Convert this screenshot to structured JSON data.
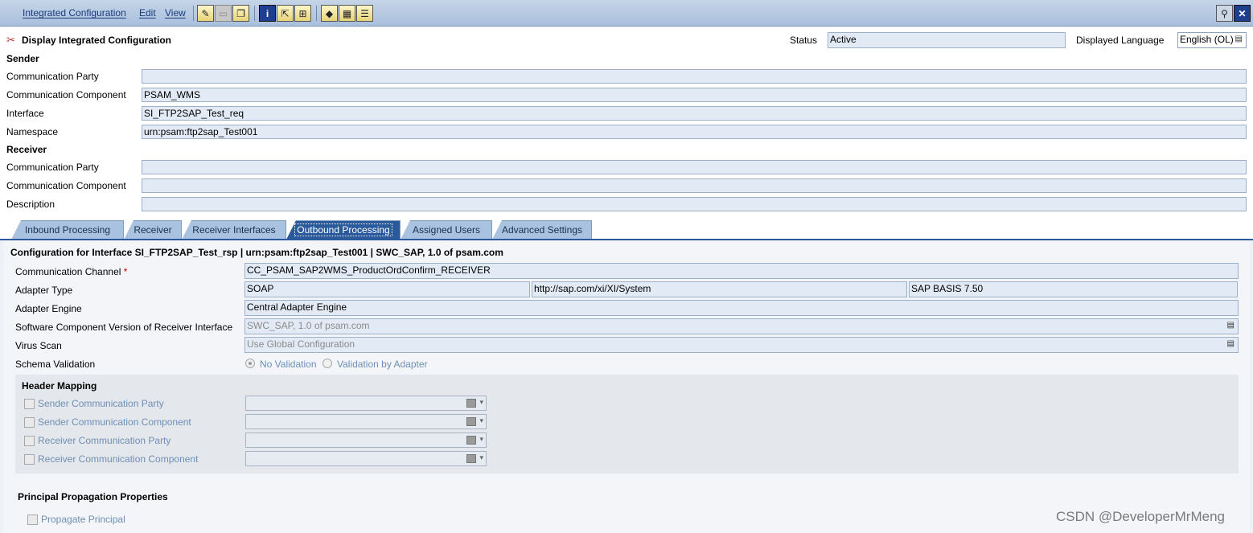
{
  "menu": {
    "integrated_config": "Integrated Configuration",
    "edit": "Edit",
    "view": "View"
  },
  "toolbar_icons": [
    "edit-pencil-icon",
    "save-icon",
    "copy-icon",
    "info-icon",
    "navigate-icon",
    "where-used-icon",
    "check-icon",
    "table-icon",
    "doc-icon",
    "pin-icon",
    "close-window-icon"
  ],
  "header": {
    "title": "Display Integrated Configuration",
    "status_label": "Status",
    "status_value": "Active",
    "language_label": "Displayed Language",
    "language_value": "English (OL)"
  },
  "sender": {
    "title": "Sender",
    "party_label": "Communication Party",
    "party_value": "",
    "component_label": "Communication Component",
    "component_value": "PSAM_WMS",
    "interface_label": "Interface",
    "interface_value": "SI_FTP2SAP_Test_req",
    "namespace_label": "Namespace",
    "namespace_value": "urn:psam:ftp2sap_Test001"
  },
  "receiver": {
    "title": "Receiver",
    "party_label": "Communication Party",
    "party_value": "",
    "component_label": "Communication Component",
    "component_value": "",
    "description_label": "Description",
    "description_value": ""
  },
  "tabs": [
    "Inbound Processing",
    "Receiver",
    "Receiver Interfaces",
    "Outbound Processing",
    "Assigned Users",
    "Advanced Settings"
  ],
  "active_tab": "Outbound Processing",
  "outbound": {
    "heading": "Configuration for Interface SI_FTP2SAP_Test_rsp | urn:psam:ftp2sap_Test001 | SWC_SAP, 1.0 of psam.com",
    "channel_label": "Communication Channel",
    "required_mark": "*",
    "channel_value": "CC_PSAM_SAP2WMS_ProductOrdConfirm_RECEIVER",
    "adapter_type_label": "Adapter Type",
    "adapter_type": "SOAP",
    "adapter_ns": "http://sap.com/xi/XI/System",
    "adapter_version": "SAP BASIS 7.50",
    "engine_label": "Adapter Engine",
    "engine_value": "Central Adapter Engine",
    "swcv_label": "Software Component Version of Receiver Interface",
    "swcv_value": "SWC_SAP, 1.0 of psam.com",
    "virus_label": "Virus Scan",
    "virus_value": "Use Global Configuration",
    "schema_label": "Schema Validation",
    "schema_opt1": "No Validation",
    "schema_opt2": "Validation by Adapter"
  },
  "header_mapping": {
    "title": "Header Mapping",
    "items": [
      "Sender Communication Party",
      "Sender Communication Component",
      "Receiver Communication Party",
      "Receiver Communication Component"
    ]
  },
  "principal": {
    "title": "Principal Propagation Properties",
    "propagate": "Propagate Principal"
  },
  "watermark": "CSDN @DeveloperMrMeng"
}
